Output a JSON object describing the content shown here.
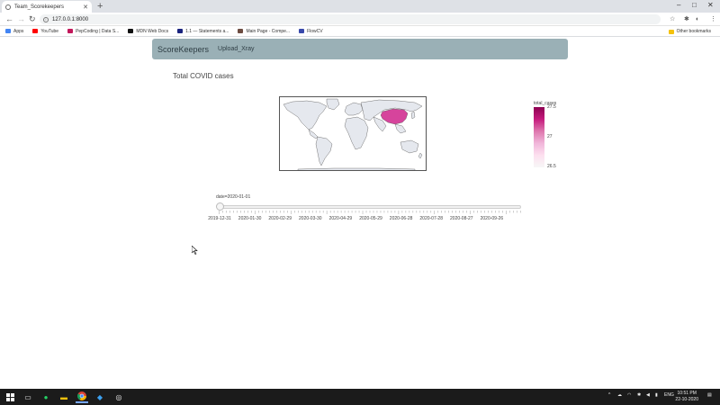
{
  "browser": {
    "tab_title": "Team_Scorekeepers",
    "new_tab_symbol": "+",
    "url": "127.0.0.1:8000",
    "window_controls": {
      "minimize": "–",
      "maximize": "□",
      "close": "✕"
    },
    "bookmarks": [
      {
        "label": "Apps",
        "color": "#4285f4"
      },
      {
        "label": "YouTube",
        "color": "#ff0000"
      },
      {
        "label": "PepCoding | Data S...",
        "color": "#c2185b"
      },
      {
        "label": "MDN Web Docs",
        "color": "#111111"
      },
      {
        "label": "1.1 — Statements a...",
        "color": "#1a237e"
      },
      {
        "label": "Main Page - Compe...",
        "color": "#6d4c41"
      },
      {
        "label": "FlowCV",
        "color": "#3949ab"
      }
    ],
    "other_bookmarks": "Other bookmarks"
  },
  "navbar": {
    "brand": "ScoreKeepers",
    "link": "Upload_Xray"
  },
  "chart": {
    "title": "Total COVID cases",
    "colorbar_title": "total_cases",
    "colorbar_ticks": [
      "27.5",
      "27",
      "26.5"
    ],
    "highlight_color": "#d6449c",
    "slider_current": "date=2020-01-01",
    "slider_dates": [
      "2019-12-31",
      "2020-01-30",
      "2020-02-29",
      "2020-03-30",
      "2020-04-29",
      "2020-05-29",
      "2020-06-28",
      "2020-07-28",
      "2020-08-27",
      "2020-09-26"
    ]
  },
  "chart_data": {
    "type": "choropleth",
    "title": "Total COVID cases",
    "colorbar": {
      "title": "total_cases",
      "range": [
        26.5,
        27.5
      ],
      "ticks": [
        27.5,
        27,
        26.5
      ]
    },
    "regions": [
      {
        "name": "China",
        "value": 27
      }
    ],
    "animation_frame": "date=2020-01-01",
    "frames": [
      "2019-12-31",
      "2020-01-30",
      "2020-02-29",
      "2020-03-30",
      "2020-04-29",
      "2020-05-29",
      "2020-06-28",
      "2020-07-28",
      "2020-08-27",
      "2020-09-26"
    ]
  },
  "taskbar": {
    "language": "ENG",
    "time": "10:51 PM",
    "date": "22-10-2020"
  }
}
